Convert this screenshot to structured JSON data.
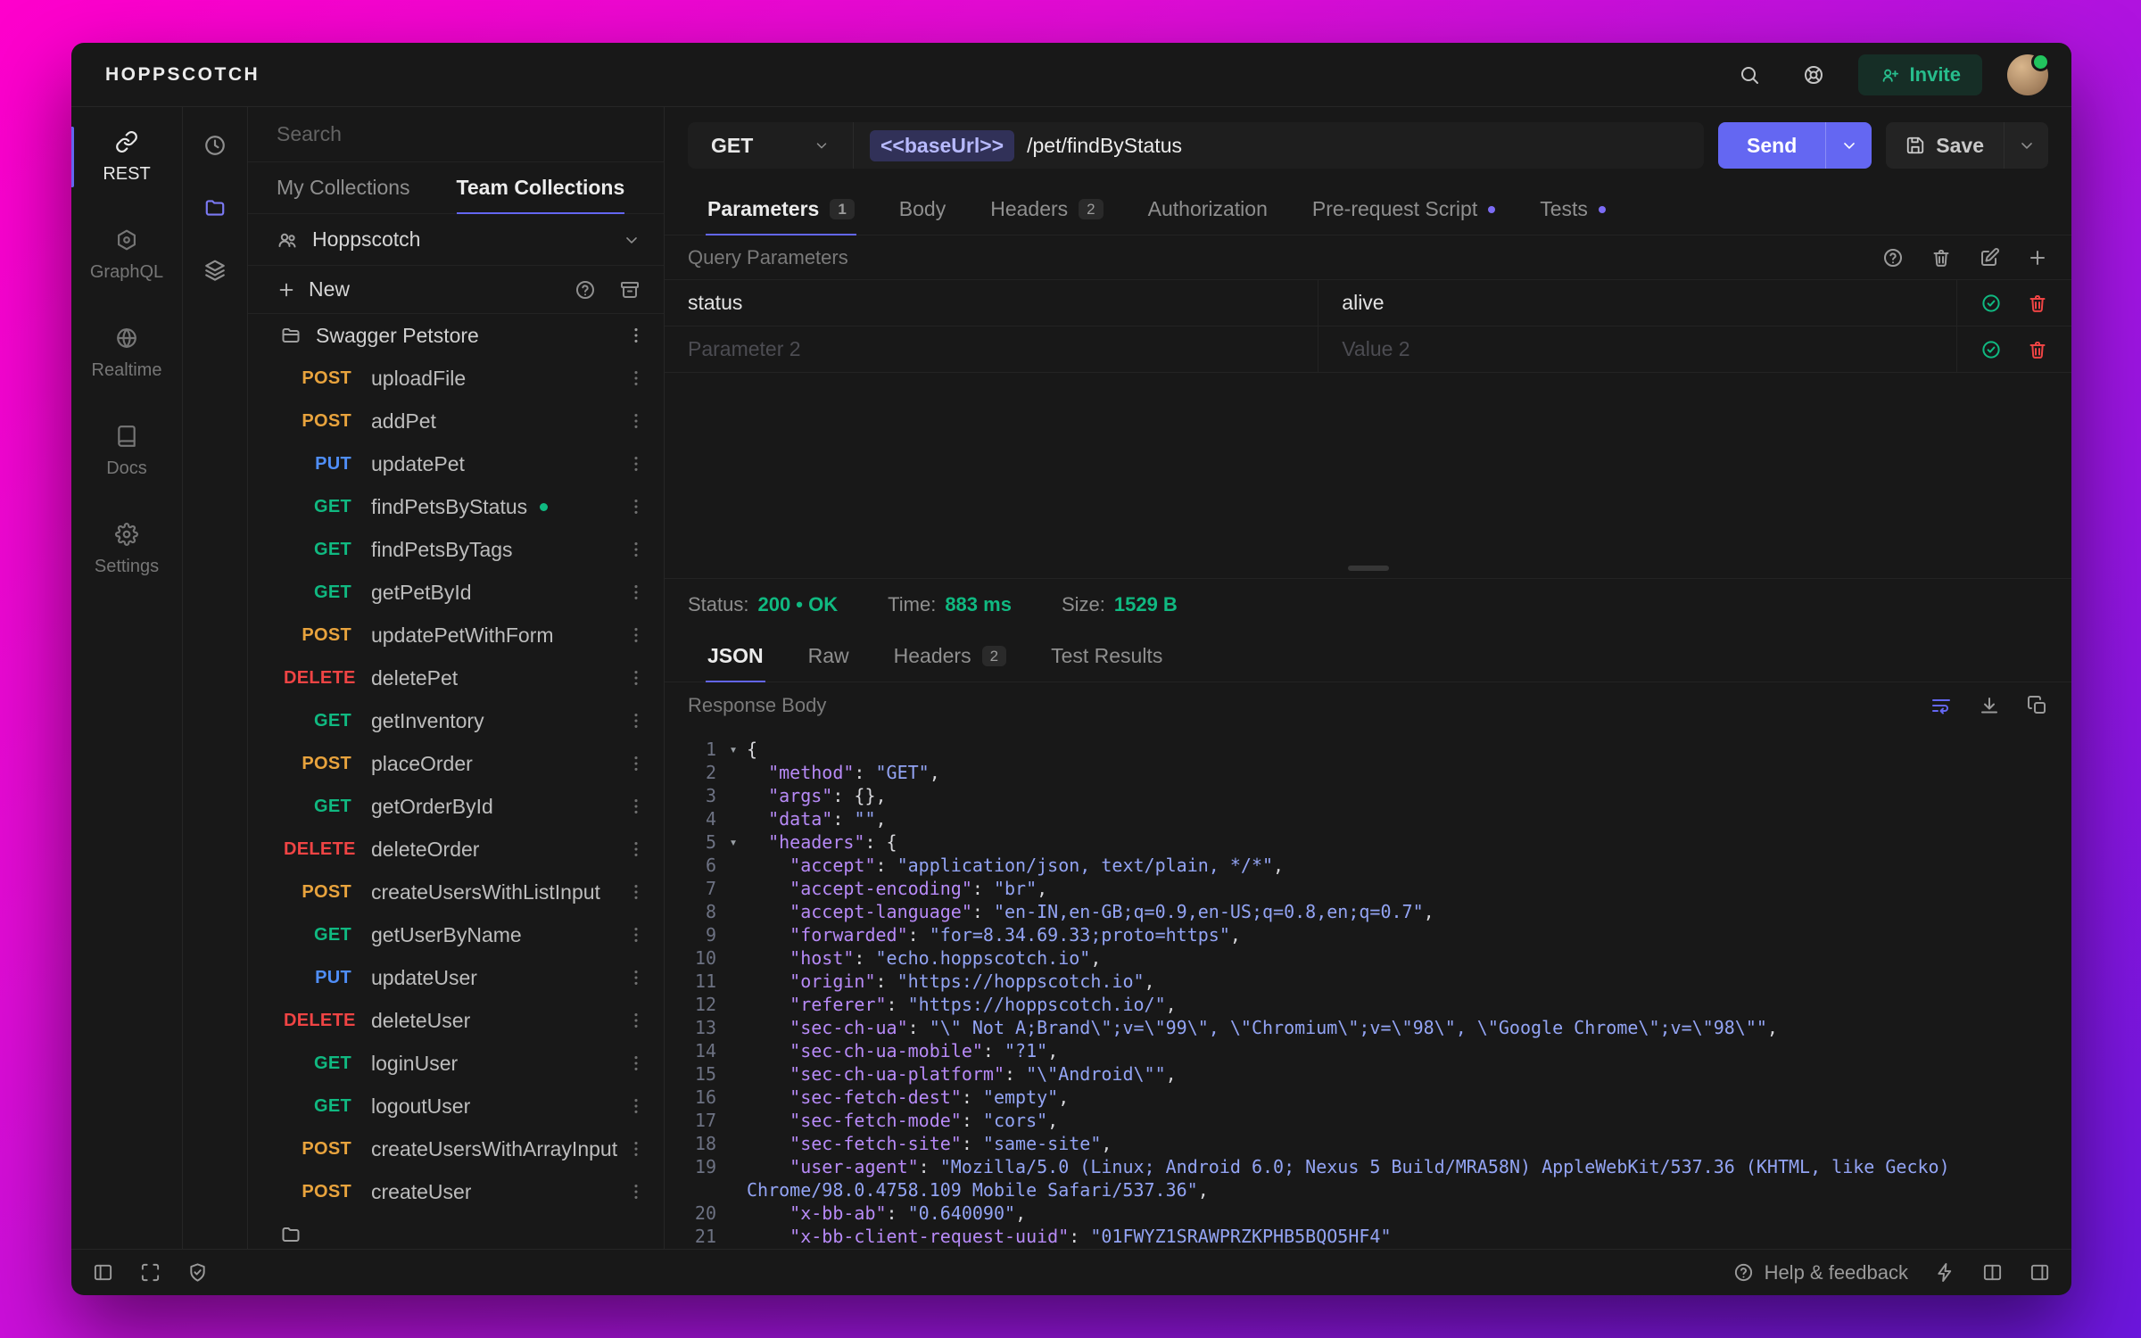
{
  "colors": {
    "accent": "#6366f1",
    "success": "#10b981",
    "method_get": "#10b981",
    "method_post": "#e8a33d",
    "method_put": "#4f8ef7",
    "method_delete": "#ef4444"
  },
  "header": {
    "logo": "HOPPSCOTCH",
    "invite_label": "Invite"
  },
  "primary_nav": {
    "items": [
      {
        "id": "rest",
        "icon": "link",
        "label": "REST",
        "active": true
      },
      {
        "id": "graphql",
        "icon": "graphql",
        "label": "GraphQL",
        "active": false
      },
      {
        "id": "realtime",
        "icon": "globe",
        "label": "Realtime",
        "active": false
      },
      {
        "id": "docs",
        "icon": "book",
        "label": "Docs",
        "active": false
      },
      {
        "id": "settings",
        "icon": "gear",
        "label": "Settings",
        "active": false
      }
    ]
  },
  "collections_panel": {
    "search_placeholder": "Search",
    "tabs": [
      {
        "label": "My Collections",
        "active": false
      },
      {
        "label": "Team Collections",
        "active": true
      }
    ],
    "team_name": "Hoppscotch",
    "new_label": "New",
    "folder_name": "Swagger Petstore",
    "requests": [
      {
        "method": "POST",
        "name": "uploadFile",
        "active": false
      },
      {
        "method": "POST",
        "name": "addPet",
        "active": false
      },
      {
        "method": "PUT",
        "name": "updatePet",
        "active": false
      },
      {
        "method": "GET",
        "name": "findPetsByStatus",
        "active": true
      },
      {
        "method": "GET",
        "name": "findPetsByTags",
        "active": false
      },
      {
        "method": "GET",
        "name": "getPetById",
        "active": false
      },
      {
        "method": "POST",
        "name": "updatePetWithForm",
        "active": false
      },
      {
        "method": "DELETE",
        "name": "deletePet",
        "active": false
      },
      {
        "method": "GET",
        "name": "getInventory",
        "active": false
      },
      {
        "method": "POST",
        "name": "placeOrder",
        "active": false
      },
      {
        "method": "GET",
        "name": "getOrderById",
        "active": false
      },
      {
        "method": "DELETE",
        "name": "deleteOrder",
        "active": false
      },
      {
        "method": "POST",
        "name": "createUsersWithListInput",
        "active": false
      },
      {
        "method": "GET",
        "name": "getUserByName",
        "active": false
      },
      {
        "method": "PUT",
        "name": "updateUser",
        "active": false
      },
      {
        "method": "DELETE",
        "name": "deleteUser",
        "active": false
      },
      {
        "method": "GET",
        "name": "loginUser",
        "active": false
      },
      {
        "method": "GET",
        "name": "logoutUser",
        "active": false
      },
      {
        "method": "POST",
        "name": "createUsersWithArrayInput",
        "active": false
      },
      {
        "method": "POST",
        "name": "createUser",
        "active": false
      }
    ]
  },
  "request": {
    "method": "GET",
    "url_chip": "<<baseUrl>>",
    "url_path": "/pet/findByStatus",
    "send_label": "Send",
    "save_label": "Save",
    "tabs": [
      {
        "label": "Parameters",
        "badge": "1",
        "active": true
      },
      {
        "label": "Body",
        "active": false
      },
      {
        "label": "Headers",
        "badge": "2",
        "active": false
      },
      {
        "label": "Authorization",
        "active": false
      },
      {
        "label": "Pre-request Script",
        "dot": true,
        "active": false
      },
      {
        "label": "Tests",
        "dot": true,
        "active": false
      }
    ],
    "section_title": "Query Parameters",
    "params": [
      {
        "key": "status",
        "value": "alive",
        "placeholder": false
      },
      {
        "key": "Parameter 2",
        "value": "Value 2",
        "placeholder": true
      }
    ]
  },
  "response": {
    "status_label": "Status:",
    "status_value": "200 • OK",
    "time_label": "Time:",
    "time_value": "883 ms",
    "size_label": "Size:",
    "size_value": "1529 B",
    "tabs": [
      {
        "label": "JSON",
        "active": true
      },
      {
        "label": "Raw",
        "active": false
      },
      {
        "label": "Headers",
        "badge": "2",
        "active": false
      },
      {
        "label": "Test Results",
        "active": false
      }
    ],
    "body_label": "Response Body",
    "code_lines": [
      {
        "n": 1,
        "fold": true,
        "tokens": [
          [
            "p",
            "{"
          ]
        ]
      },
      {
        "n": 2,
        "tokens": [
          [
            "p",
            "  "
          ],
          [
            "k",
            "\"method\""
          ],
          [
            "p",
            ": "
          ],
          [
            "s",
            "\"GET\""
          ],
          [
            "p",
            ","
          ]
        ]
      },
      {
        "n": 3,
        "tokens": [
          [
            "p",
            "  "
          ],
          [
            "k",
            "\"args\""
          ],
          [
            "p",
            ": {},"
          ]
        ]
      },
      {
        "n": 4,
        "tokens": [
          [
            "p",
            "  "
          ],
          [
            "k",
            "\"data\""
          ],
          [
            "p",
            ": "
          ],
          [
            "s",
            "\"\""
          ],
          [
            "p",
            ","
          ]
        ]
      },
      {
        "n": 5,
        "fold": true,
        "tokens": [
          [
            "p",
            "  "
          ],
          [
            "k",
            "\"headers\""
          ],
          [
            "p",
            ": {"
          ]
        ]
      },
      {
        "n": 6,
        "tokens": [
          [
            "p",
            "    "
          ],
          [
            "k",
            "\"accept\""
          ],
          [
            "p",
            ": "
          ],
          [
            "s",
            "\"application/json, text/plain, */*\""
          ],
          [
            "p",
            ","
          ]
        ]
      },
      {
        "n": 7,
        "tokens": [
          [
            "p",
            "    "
          ],
          [
            "k",
            "\"accept-encoding\""
          ],
          [
            "p",
            ": "
          ],
          [
            "s",
            "\"br\""
          ],
          [
            "p",
            ","
          ]
        ]
      },
      {
        "n": 8,
        "tokens": [
          [
            "p",
            "    "
          ],
          [
            "k",
            "\"accept-language\""
          ],
          [
            "p",
            ": "
          ],
          [
            "s",
            "\"en-IN,en-GB;q=0.9,en-US;q=0.8,en;q=0.7\""
          ],
          [
            "p",
            ","
          ]
        ]
      },
      {
        "n": 9,
        "tokens": [
          [
            "p",
            "    "
          ],
          [
            "k",
            "\"forwarded\""
          ],
          [
            "p",
            ": "
          ],
          [
            "s",
            "\"for=8.34.69.33;proto=https\""
          ],
          [
            "p",
            ","
          ]
        ]
      },
      {
        "n": 10,
        "tokens": [
          [
            "p",
            "    "
          ],
          [
            "k",
            "\"host\""
          ],
          [
            "p",
            ": "
          ],
          [
            "s",
            "\"echo.hoppscotch.io\""
          ],
          [
            "p",
            ","
          ]
        ]
      },
      {
        "n": 11,
        "tokens": [
          [
            "p",
            "    "
          ],
          [
            "k",
            "\"origin\""
          ],
          [
            "p",
            ": "
          ],
          [
            "s",
            "\"https://hoppscotch.io\""
          ],
          [
            "p",
            ","
          ]
        ]
      },
      {
        "n": 12,
        "tokens": [
          [
            "p",
            "    "
          ],
          [
            "k",
            "\"referer\""
          ],
          [
            "p",
            ": "
          ],
          [
            "s",
            "\"https://hoppscotch.io/\""
          ],
          [
            "p",
            ","
          ]
        ]
      },
      {
        "n": 13,
        "tokens": [
          [
            "p",
            "    "
          ],
          [
            "k",
            "\"sec-ch-ua\""
          ],
          [
            "p",
            ": "
          ],
          [
            "s",
            "\"\\\" Not A;Brand\\\";v=\\\"99\\\", \\\"Chromium\\\";v=\\\"98\\\", \\\"Google Chrome\\\";v=\\\"98\\\"\""
          ],
          [
            "p",
            ","
          ]
        ]
      },
      {
        "n": 14,
        "tokens": [
          [
            "p",
            "    "
          ],
          [
            "k",
            "\"sec-ch-ua-mobile\""
          ],
          [
            "p",
            ": "
          ],
          [
            "s",
            "\"?1\""
          ],
          [
            "p",
            ","
          ]
        ]
      },
      {
        "n": 15,
        "tokens": [
          [
            "p",
            "    "
          ],
          [
            "k",
            "\"sec-ch-ua-platform\""
          ],
          [
            "p",
            ": "
          ],
          [
            "s",
            "\"\\\"Android\\\"\""
          ],
          [
            "p",
            ","
          ]
        ]
      },
      {
        "n": 16,
        "tokens": [
          [
            "p",
            "    "
          ],
          [
            "k",
            "\"sec-fetch-dest\""
          ],
          [
            "p",
            ": "
          ],
          [
            "s",
            "\"empty\""
          ],
          [
            "p",
            ","
          ]
        ]
      },
      {
        "n": 17,
        "tokens": [
          [
            "p",
            "    "
          ],
          [
            "k",
            "\"sec-fetch-mode\""
          ],
          [
            "p",
            ": "
          ],
          [
            "s",
            "\"cors\""
          ],
          [
            "p",
            ","
          ]
        ]
      },
      {
        "n": 18,
        "tokens": [
          [
            "p",
            "    "
          ],
          [
            "k",
            "\"sec-fetch-site\""
          ],
          [
            "p",
            ": "
          ],
          [
            "s",
            "\"same-site\""
          ],
          [
            "p",
            ","
          ]
        ]
      },
      {
        "n": 19,
        "tokens": [
          [
            "p",
            "    "
          ],
          [
            "k",
            "\"user-agent\""
          ],
          [
            "p",
            ": "
          ],
          [
            "s",
            "\"Mozilla/5.0 (Linux; Android 6.0; Nexus 5 Build/MRA58N) AppleWebKit/537.36 (KHTML, like Gecko) Chrome/98.0.4758.109 Mobile Safari/537.36\""
          ],
          [
            "p",
            ","
          ]
        ]
      },
      {
        "n": 20,
        "tokens": [
          [
            "p",
            "    "
          ],
          [
            "k",
            "\"x-bb-ab\""
          ],
          [
            "p",
            ": "
          ],
          [
            "s",
            "\"0.640090\""
          ],
          [
            "p",
            ","
          ]
        ]
      },
      {
        "n": 21,
        "tokens": [
          [
            "p",
            "    "
          ],
          [
            "k",
            "\"x-bb-client-request-uuid\""
          ],
          [
            "p",
            ": "
          ],
          [
            "s",
            "\"01FWYZ1SRAWPRZKPHB5BQO5HF4\""
          ]
        ]
      }
    ]
  },
  "footer": {
    "help_label": "Help & feedback"
  }
}
